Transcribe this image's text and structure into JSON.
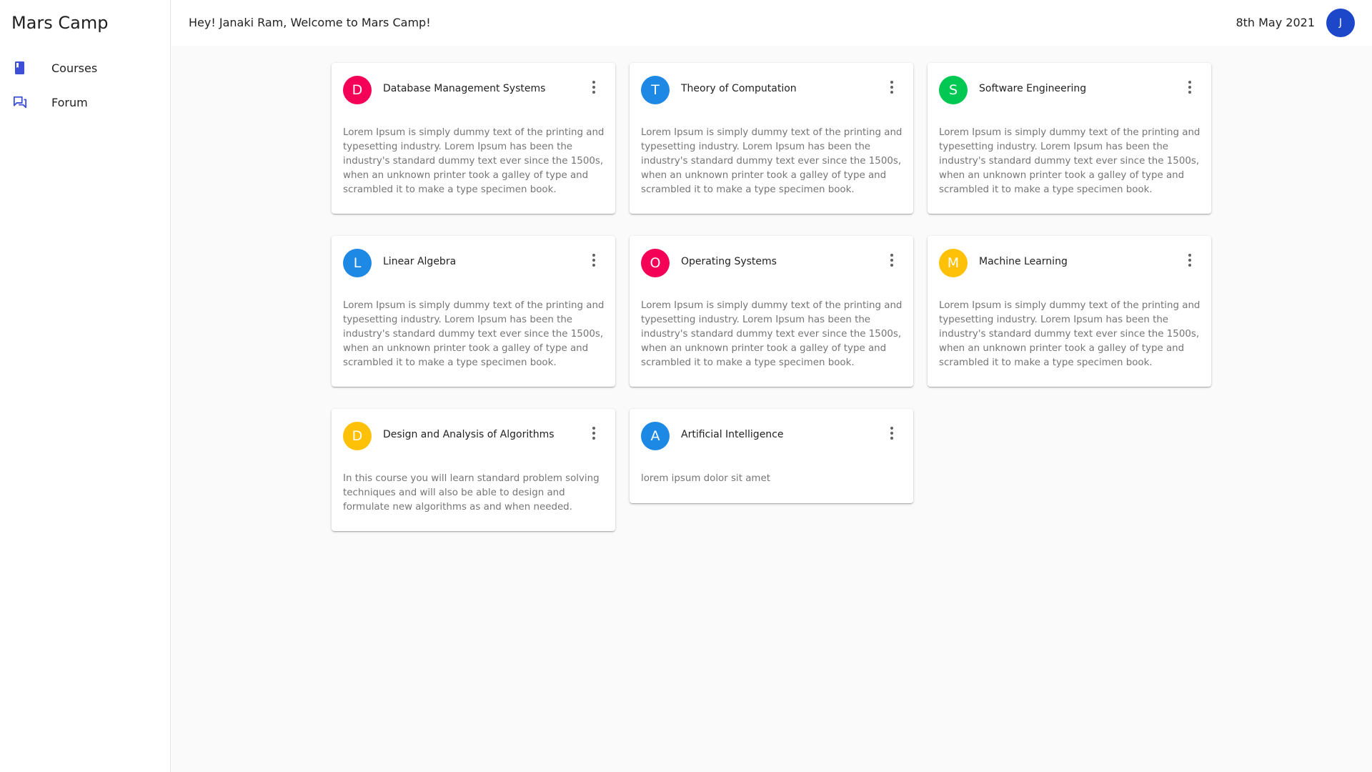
{
  "app": {
    "title": "Mars Camp"
  },
  "sidebar": {
    "items": [
      {
        "label": "Courses",
        "icon": "book-icon"
      },
      {
        "label": "Forum",
        "icon": "forum-icon"
      }
    ]
  },
  "header": {
    "welcome": "Hey! Janaki Ram, Welcome to Mars Camp!",
    "date": "8th May 2021",
    "avatar_initial": "J",
    "avatar_color": "#1c47c9"
  },
  "courses": [
    {
      "initial": "D",
      "color": "#f50057",
      "title": "Database Management Systems",
      "description": "Lorem Ipsum is simply dummy text of the printing and typesetting industry. Lorem Ipsum has been the industry's standard dummy text ever since the 1500s, when an unknown printer took a galley of type and scrambled it to make a type specimen book."
    },
    {
      "initial": "T",
      "color": "#1e88e5",
      "title": "Theory of Computation",
      "description": "Lorem Ipsum is simply dummy text of the printing and typesetting industry. Lorem Ipsum has been the industry's standard dummy text ever since the 1500s, when an unknown printer took a galley of type and scrambled it to make a type specimen book."
    },
    {
      "initial": "S",
      "color": "#00c853",
      "title": "Software Engineering",
      "description": "Lorem Ipsum is simply dummy text of the printing and typesetting industry. Lorem Ipsum has been the industry's standard dummy text ever since the 1500s, when an unknown printer took a galley of type and scrambled it to make a type specimen book."
    },
    {
      "initial": "L",
      "color": "#1e88e5",
      "title": "Linear Algebra",
      "description": "Lorem Ipsum is simply dummy text of the printing and typesetting industry. Lorem Ipsum has been the industry's standard dummy text ever since the 1500s, when an unknown printer took a galley of type and scrambled it to make a type specimen book."
    },
    {
      "initial": "O",
      "color": "#f50057",
      "title": "Operating Systems",
      "description": "Lorem Ipsum is simply dummy text of the printing and typesetting industry. Lorem Ipsum has been the industry's standard dummy text ever since the 1500s, when an unknown printer took a galley of type and scrambled it to make a type specimen book."
    },
    {
      "initial": "M",
      "color": "#ffc107",
      "title": "Machine Learning",
      "description": "Lorem Ipsum is simply dummy text of the printing and typesetting industry. Lorem Ipsum has been the industry's standard dummy text ever since the 1500s, when an unknown printer took a galley of type and scrambled it to make a type specimen book."
    },
    {
      "initial": "D",
      "color": "#ffc107",
      "title": "Design and Analysis of Algorithms",
      "description": "In this course you will learn standard problem solving techniques and will also be able to design and formulate new algorithms as and when needed."
    },
    {
      "initial": "A",
      "color": "#1e88e5",
      "title": "Artificial Intelligence",
      "description": "lorem ipsum dolor sit amet"
    }
  ],
  "colors": {
    "sidebar_accent": "#3d4fd6",
    "text_secondary": "#757575"
  }
}
